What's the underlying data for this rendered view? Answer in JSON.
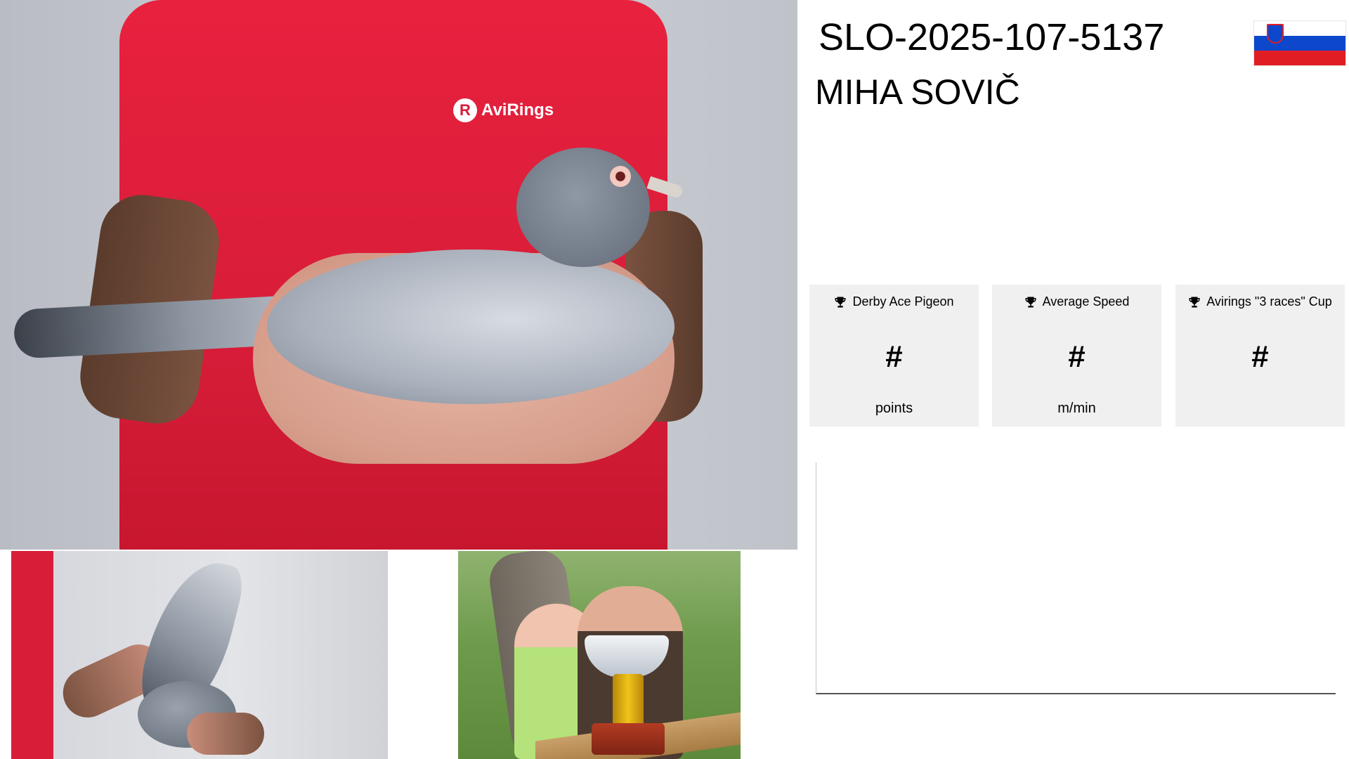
{
  "header": {
    "ring_number": "SLO-2025-107-5137",
    "owner_name": "MIHA SOVIČ",
    "flag": {
      "country": "Slovenia",
      "colors": [
        "#ffffff",
        "#0d47cc",
        "#e11d24"
      ]
    }
  },
  "photos": {
    "main": {
      "logo_text": "AviRings",
      "logo_mark": "R"
    }
  },
  "stats": [
    {
      "title": "Derby Ace Pigeon",
      "value": "#",
      "unit": "points",
      "icon": "trophy-icon"
    },
    {
      "title": "Average Speed",
      "value": "#",
      "unit": "m/min",
      "icon": "trophy-icon"
    },
    {
      "title": "Avirings \"3 races\" Cup",
      "value": "#",
      "unit": "",
      "icon": "trophy-icon"
    }
  ],
  "colors": {
    "card_background": "#f0f0f0",
    "shirt_red": "#d81d39",
    "text": "#000000"
  }
}
